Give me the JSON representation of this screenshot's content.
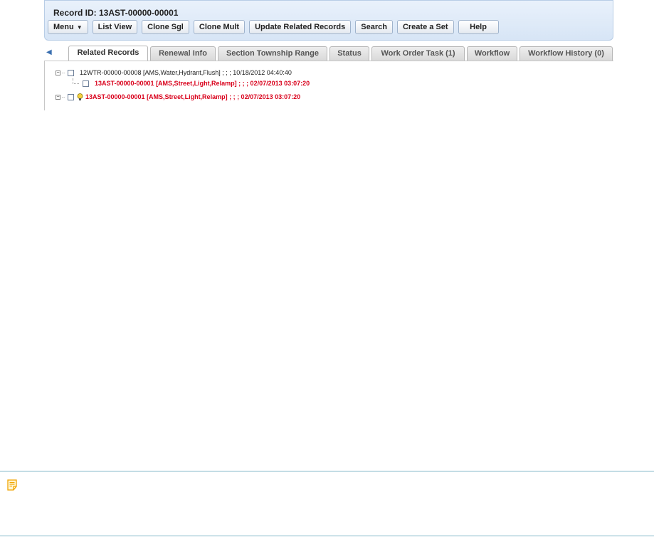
{
  "header": {
    "record_id": "Record ID: 13AST-00000-00001"
  },
  "toolbar": {
    "buttons": [
      {
        "label": "Menu",
        "icon": "menu-caret"
      },
      {
        "label": "List View"
      },
      {
        "label": "Clone Sgl"
      },
      {
        "label": "Clone Mult"
      },
      {
        "label": "Update Related Records"
      },
      {
        "label": "Search"
      },
      {
        "label": "Create a Set"
      },
      {
        "label": "Help"
      }
    ]
  },
  "tabs": {
    "active": "Related Records",
    "items": [
      {
        "label": "Related Records"
      },
      {
        "label": "Renewal Info"
      },
      {
        "label": "Section Township Range"
      },
      {
        "label": "Status"
      },
      {
        "label": "Work Order Task (1)"
      },
      {
        "label": "Workflow"
      },
      {
        "label": "Workflow History (0)"
      }
    ]
  },
  "tree": {
    "rows": [
      {
        "text": "12WTR-00000-00008  [AMS,Water,Hydrant,Flush]  ; ; ;  10/18/2012 04:40:40",
        "highlight": false
      },
      {
        "text": "13AST-00000-00001  [AMS,Street,Light,Relamp]  ; ; ;  02/07/2013 03:07:20",
        "highlight": true
      },
      {
        "text": "13AST-00000-00001  [AMS,Street,Light,Relamp]  ; ; ;  02/07/2013 03:07:20",
        "highlight": true,
        "icon": "lightbulb-icon"
      }
    ]
  },
  "note": {
    "icon": "note-icon",
    "color": "#f0a500"
  },
  "colors": {
    "highlight_text": "#d9001b",
    "panel_border": "#b8cde6",
    "note_rule": "#7fb6c7"
  }
}
